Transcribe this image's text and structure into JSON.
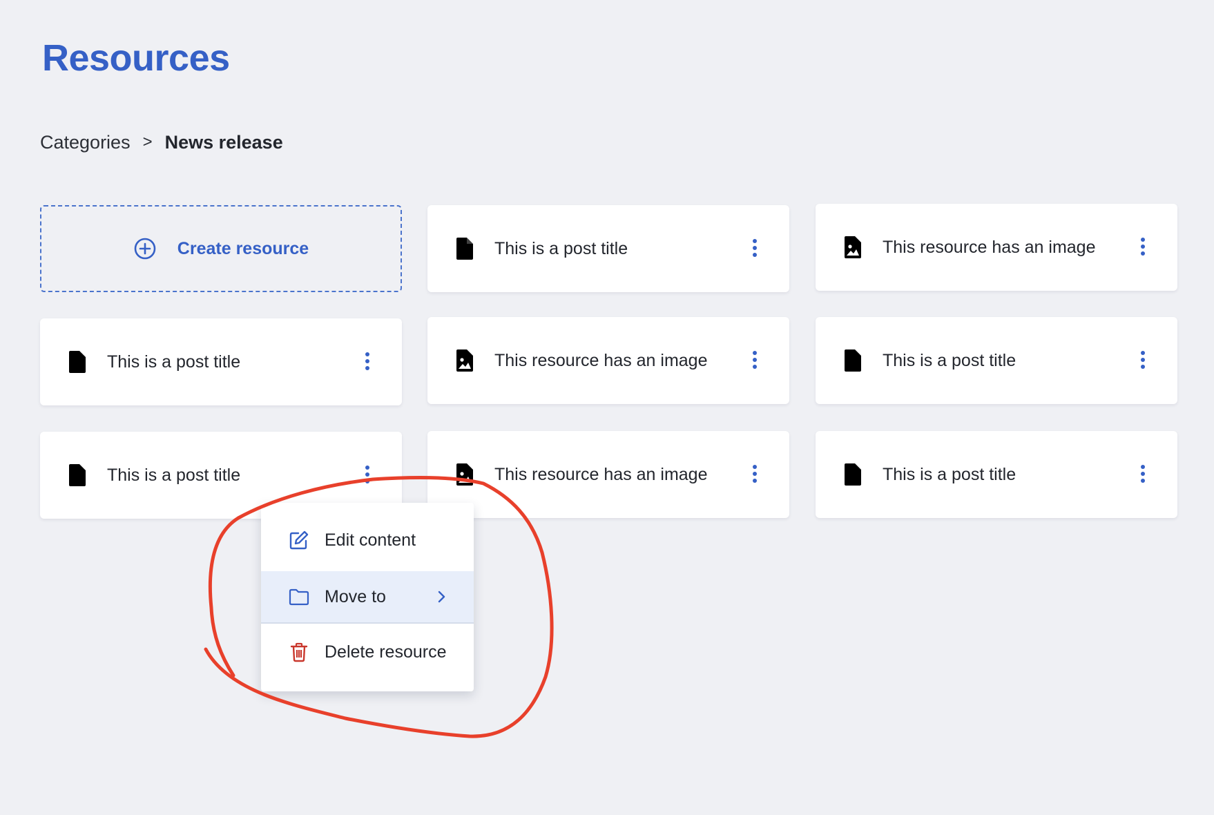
{
  "page": {
    "title": "Resources"
  },
  "breadcrumb": {
    "parent": "Categories",
    "separator": ">",
    "current": "News release"
  },
  "create_card": {
    "label": "Create resource",
    "icon": "plus-circle-icon"
  },
  "cards": [
    {
      "title": "This is a post title",
      "icon": "file-icon"
    },
    {
      "title": "This resource has an image",
      "icon": "image-file-icon"
    },
    {
      "title": "This is a post title",
      "icon": "file-icon"
    },
    {
      "title": "This resource has an image",
      "icon": "image-file-icon"
    },
    {
      "title": "This is a post title",
      "icon": "file-icon"
    },
    {
      "title": "This is a post title",
      "icon": "file-icon"
    },
    {
      "title": "This resource has an image",
      "icon": "image-file-icon"
    },
    {
      "title": "This is a post title",
      "icon": "file-icon"
    }
  ],
  "context_menu": {
    "items": [
      {
        "label": "Edit content",
        "icon": "edit-icon"
      },
      {
        "label": "Move to",
        "icon": "folder-icon",
        "has_submenu": true,
        "highlighted": true
      },
      {
        "label": "Delete resource",
        "icon": "trash-icon"
      }
    ]
  },
  "colors": {
    "background": "#eff0f4",
    "accent": "#3560c6",
    "danger": "#c9372c",
    "annotation": "#e8402b",
    "hover": "#e8eefa"
  }
}
